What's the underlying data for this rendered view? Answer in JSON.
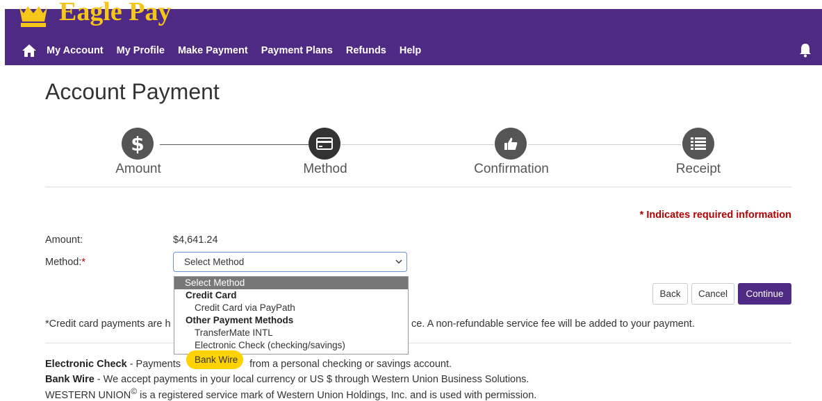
{
  "brand": {
    "name": "Eagle Pay"
  },
  "nav": {
    "items": [
      "My Account",
      "My Profile",
      "Make Payment",
      "Payment Plans",
      "Refunds",
      "Help"
    ]
  },
  "page": {
    "title": "Account Payment"
  },
  "steps": [
    "Amount",
    "Method",
    "Confirmation",
    "Receipt"
  ],
  "form": {
    "required_note": "* Indicates required information",
    "amount_label": "Amount:",
    "amount_value": "$4,641.24",
    "method_label": "Method:",
    "method_selected": "Select Method"
  },
  "dropdown": {
    "selected": "Select Method",
    "group_credit": "Credit Card",
    "opt_paypath": "Credit Card via PayPath",
    "group_other": "Other Payment Methods",
    "opt_transfermate": "TransferMate INTL",
    "opt_echeck": "Electronic Check (checking/savings)",
    "opt_bankwire": "Bank Wire"
  },
  "buttons": {
    "back": "Back",
    "cancel": "Cancel",
    "continue": "Continue"
  },
  "notes": {
    "credit_prefix": "*Credit card payments are h",
    "credit_suffix": "ce. A non-refundable service fee will be added to your payment."
  },
  "info": {
    "echeck_title": "Electronic Check",
    "echeck_prefix": " - Payments ",
    "echeck_rest": "from a personal checking or savings account.",
    "bankwire_title": "Bank Wire",
    "bankwire_text": " - We accept payments in your local currency or US $ through Western Union Business Solutions.",
    "wu_text": "WESTERN UNION",
    "wu_mark": "©",
    "wu_rest": " is a registered service mark of Western Union Holdings, Inc. and is used with permission."
  },
  "colors": {
    "header": "#4e2a84",
    "brand": "#f5c518",
    "required": "#b30000",
    "highlight": "#ffd200"
  }
}
